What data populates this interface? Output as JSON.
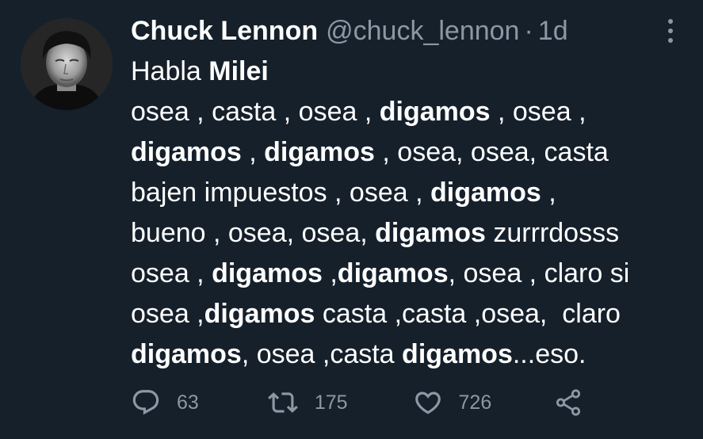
{
  "author": {
    "name": "Chuck Lennon",
    "handle": "@chuck_lennon",
    "separator": "·",
    "time": "1d"
  },
  "tweet": {
    "lines": [
      [
        {
          "t": "Habla ",
          "b": false
        },
        {
          "t": "Milei",
          "b": true
        }
      ],
      [
        {
          "t": "osea , casta , osea , ",
          "b": false
        },
        {
          "t": "digamos",
          "b": true
        },
        {
          "t": " , osea ,",
          "b": false
        }
      ],
      [
        {
          "t": "digamos",
          "b": true
        },
        {
          "t": " , ",
          "b": false
        },
        {
          "t": "digamos",
          "b": true
        },
        {
          "t": " , osea, osea, casta",
          "b": false
        }
      ],
      [
        {
          "t": "bajen impuestos , osea , ",
          "b": false
        },
        {
          "t": "digamos",
          "b": true
        },
        {
          "t": " ,",
          "b": false
        }
      ],
      [
        {
          "t": "bueno , osea, osea, ",
          "b": false
        },
        {
          "t": "digamos",
          "b": true
        },
        {
          "t": " zurrrdosss",
          "b": false
        }
      ],
      [
        {
          "t": "osea , ",
          "b": false
        },
        {
          "t": "digamos",
          "b": true
        },
        {
          "t": " ,",
          "b": false
        },
        {
          "t": "digamos",
          "b": true
        },
        {
          "t": ", osea , claro si",
          "b": false
        }
      ],
      [
        {
          "t": "osea ,",
          "b": false
        },
        {
          "t": "digamos",
          "b": true
        },
        {
          "t": " casta ,casta ,osea,  claro",
          "b": false
        }
      ],
      [
        {
          "t": "digamos",
          "b": true
        },
        {
          "t": ", osea ,casta ",
          "b": false
        },
        {
          "t": "digamos",
          "b": true
        },
        {
          "t": "...eso.",
          "b": false
        }
      ]
    ]
  },
  "actions": {
    "reply_count": "63",
    "retweet_count": "175",
    "like_count": "726"
  },
  "icons": {
    "reply": "reply-icon",
    "retweet": "retweet-icon",
    "like": "heart-icon",
    "share": "share-icon",
    "more": "more-options-icon"
  },
  "colors": {
    "background": "#15202b",
    "text": "#ffffff",
    "secondary": "#8b98a5"
  }
}
